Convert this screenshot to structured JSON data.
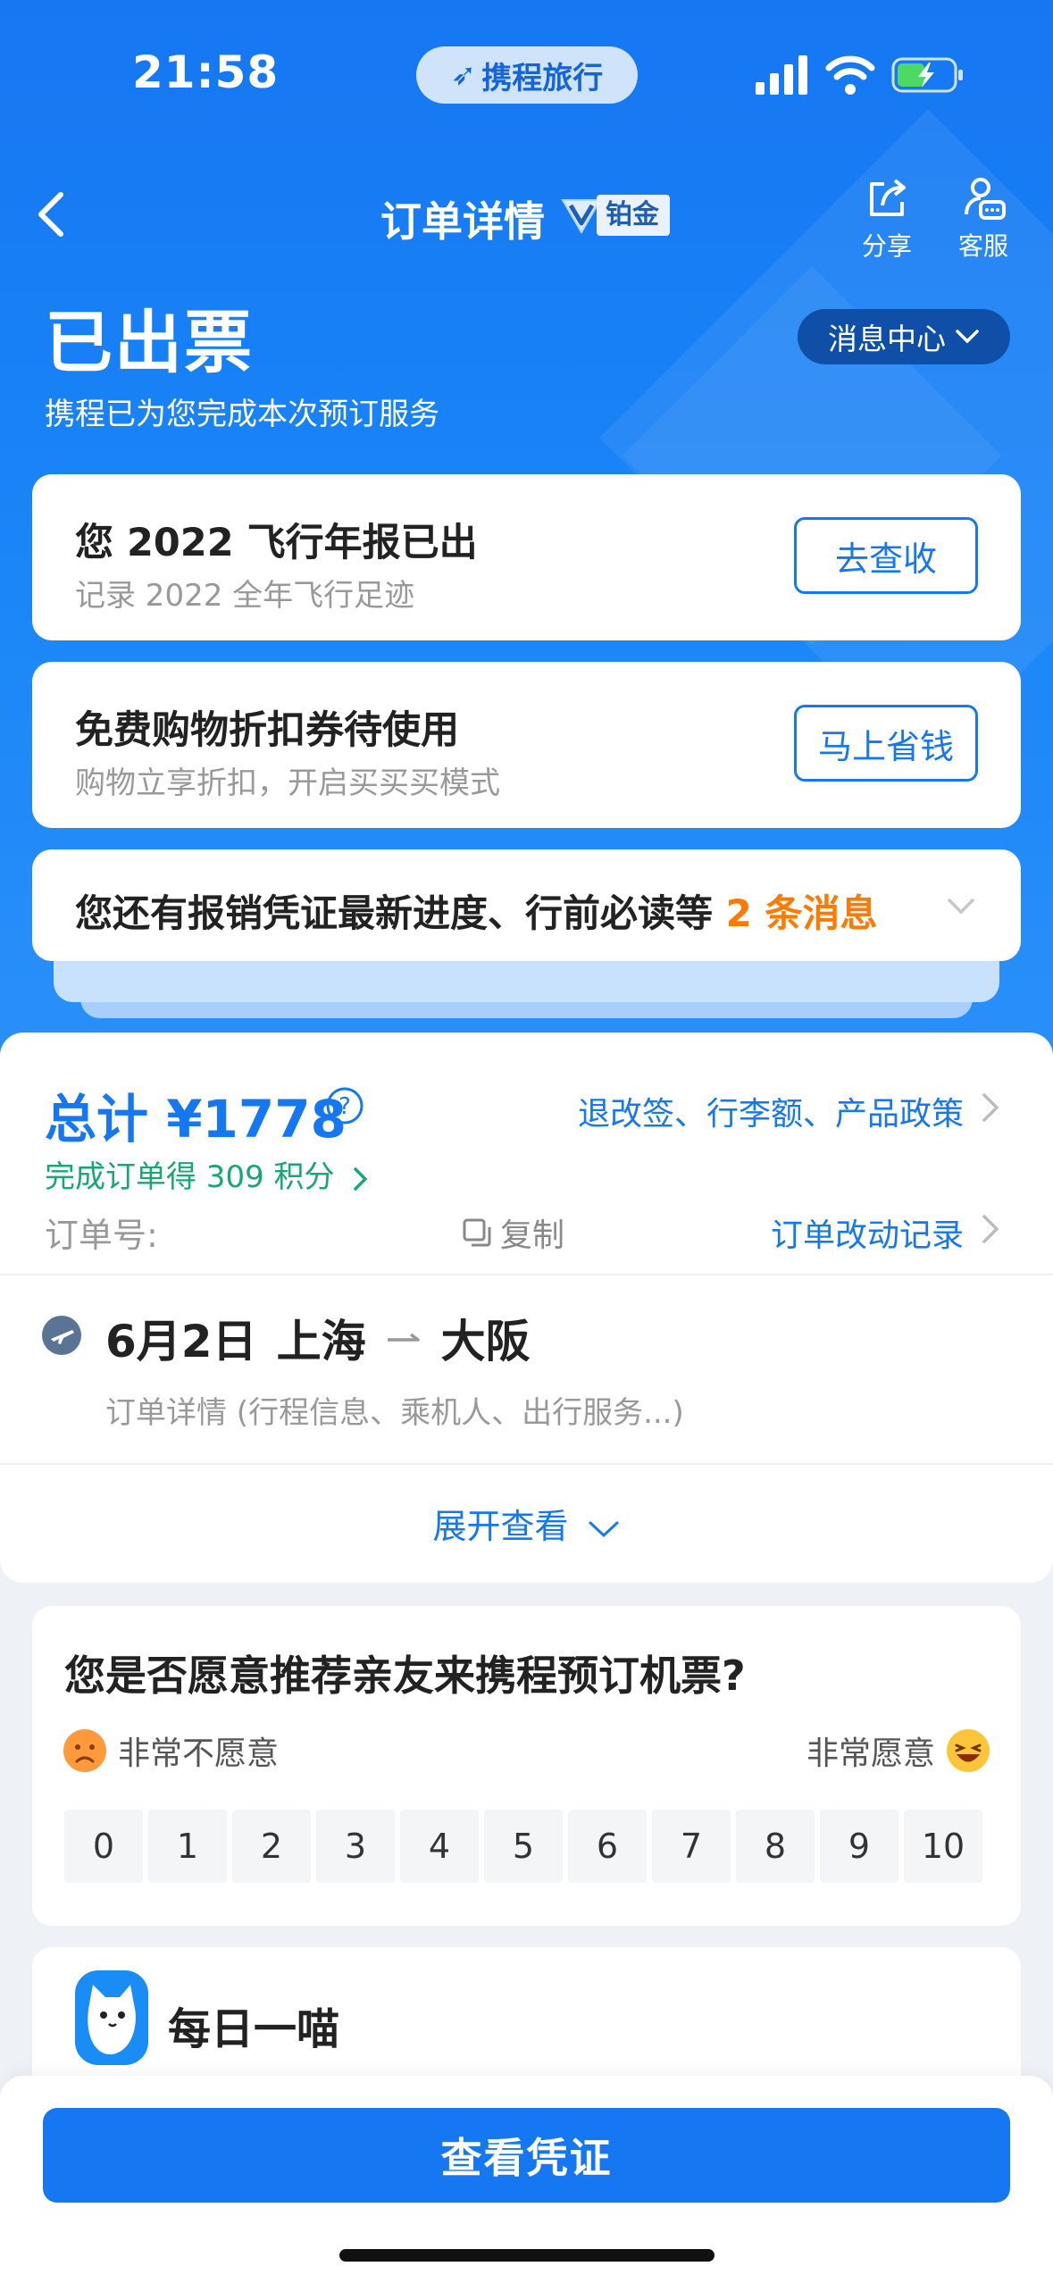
{
  "status_bar": {
    "time": "21:58",
    "app_pill": "携程旅行"
  },
  "nav": {
    "title": "订单详情",
    "badge": "铂金",
    "share_label": "分享",
    "service_label": "客服"
  },
  "header": {
    "status": "已出票",
    "subtitle": "携程已为您完成本次预订服务",
    "message_center": "消息中心"
  },
  "promo_cards": [
    {
      "title": "您 2022 飞行年报已出",
      "subtitle": "记录 2022 全年飞行足迹",
      "button": "去查收"
    },
    {
      "title": "免费购物折扣券待使用",
      "subtitle": "购物立享折扣，开启买买买模式",
      "button": "马上省钱"
    }
  ],
  "notice": {
    "text": "您还有报销凭证最新进度、行前必读等 ",
    "count": "2 条消息"
  },
  "order": {
    "total": "总计 ¥1778",
    "policy_link": "退改签、行李额、产品政策",
    "points": "完成订单得 309 积分",
    "order_number_label": "订单号:",
    "copy_label": "复制",
    "change_record": "订单改动记录",
    "date": "6月2日",
    "origin": "上海",
    "destination": "大阪",
    "detail_hint": "订单详情 (行程信息、乘机人、出行服务...)",
    "expand_label": "展开查看"
  },
  "survey": {
    "question": "您是否愿意推荐亲友来携程预订机票?",
    "low_label": "非常不愿意",
    "high_label": "非常愿意",
    "scale": [
      "0",
      "1",
      "2",
      "3",
      "4",
      "5",
      "6",
      "7",
      "8",
      "9",
      "10"
    ]
  },
  "daily_cat": {
    "title": "每日一喵"
  },
  "bottom": {
    "primary_button": "查看凭证"
  },
  "colors": {
    "brand_blue": "#1677f2",
    "accent_orange": "#ff7a00",
    "points_green": "#16a772"
  }
}
